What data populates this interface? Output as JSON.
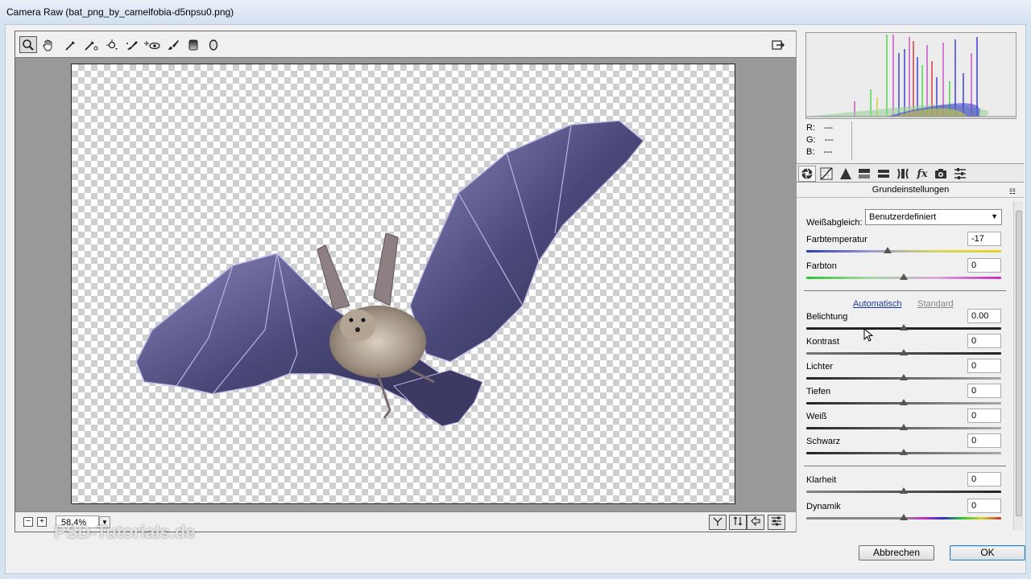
{
  "window": {
    "title": "Camera Raw (bat_png_by_camelfobia-d5npsu0.png)"
  },
  "toolbar": {
    "tools": [
      {
        "name": "zoom-tool-icon",
        "glyph": "🔍"
      },
      {
        "name": "hand-tool-icon",
        "glyph": "✋"
      },
      {
        "name": "white-balance-tool-icon",
        "glyph": "⟋"
      },
      {
        "name": "color-sampler-tool-icon",
        "glyph": "✎"
      },
      {
        "name": "targeted-adjustment-tool-icon",
        "glyph": "⊕"
      },
      {
        "name": "spot-removal-tool-icon",
        "glyph": "✐"
      },
      {
        "name": "red-eye-removal-tool-icon",
        "glyph": "+◉"
      },
      {
        "name": "adjustment-brush-icon",
        "glyph": "✒"
      },
      {
        "name": "graduated-filter-icon",
        "glyph": "▮"
      },
      {
        "name": "radial-filter-icon",
        "glyph": "◯"
      }
    ],
    "fullscreen_icon": "⇥"
  },
  "preview_footer": {
    "zoom_out": "−",
    "zoom_in": "+",
    "zoom_value": "58,4%",
    "zoom_dropdown": "▼"
  },
  "watermark": "PSD-Tutorials.de",
  "histogram": {
    "r_label": "R:",
    "r_value": "---",
    "g_label": "G:",
    "g_value": "---",
    "b_label": "B:",
    "b_value": "---"
  },
  "panel": {
    "tabs": [
      "◉",
      "▦",
      "▲",
      "▬",
      "▭",
      "Ⅱ",
      "fx",
      "◘",
      "☰"
    ],
    "section_title": "Grundeinstellungen",
    "menu_icon": "☷",
    "white_balance": {
      "label": "Weißabgleich:",
      "value": "Benutzerdefiniert"
    },
    "temp": {
      "label": "Farbtemperatur",
      "value": "-17"
    },
    "tint": {
      "label": "Farbton",
      "value": "0"
    },
    "auto_link": "Automatisch",
    "standard_link": "Standard",
    "tone": [
      {
        "label": "Belichtung",
        "value": "0.00",
        "position": 0.5
      },
      {
        "label": "Kontrast",
        "value": "0",
        "position": 0.5
      },
      {
        "label": "Lichter",
        "value": "0",
        "position": 0.5
      },
      {
        "label": "Tiefen",
        "value": "0",
        "position": 0.5
      },
      {
        "label": "Weiß",
        "value": "0",
        "position": 0.5
      },
      {
        "label": "Schwarz",
        "value": "0",
        "position": 0.5
      }
    ],
    "presence": [
      {
        "label": "Klarheit",
        "value": "0",
        "position": 0.5
      },
      {
        "label": "Dynamik",
        "value": "0",
        "position": 0.5
      }
    ]
  },
  "buttons": {
    "cancel": "Abbrechen",
    "ok": "OK"
  },
  "colors": {
    "accent": "#3c7fb1",
    "link": "#1a3b9c"
  }
}
